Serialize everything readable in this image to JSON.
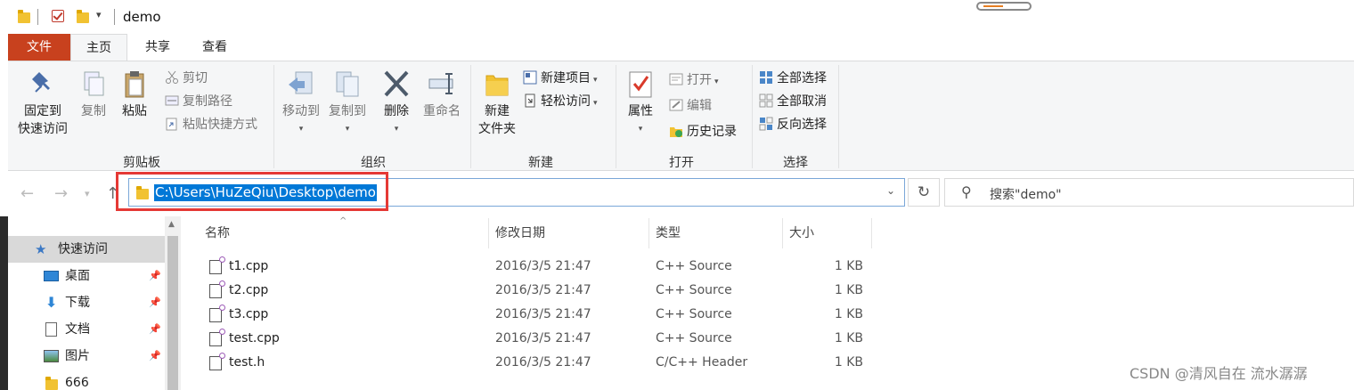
{
  "titlebar": {
    "title": "demo",
    "progress": 0.45,
    "progress_color": "#e67e22"
  },
  "tabs": {
    "file": "文件",
    "home": "主页",
    "share": "共享",
    "view": "查看"
  },
  "ribbon": {
    "clipboard": {
      "label": "剪贴板",
      "pin_line1": "固定到",
      "pin_line2": "快速访问",
      "copy": "复制",
      "paste": "粘贴",
      "cut": "剪切",
      "copy_path": "复制路径",
      "paste_shortcut": "粘贴快捷方式"
    },
    "organize": {
      "label": "组织",
      "move_to": "移动到",
      "copy_to": "复制到",
      "delete": "删除",
      "rename": "重命名"
    },
    "new": {
      "label": "新建",
      "new_folder_line1": "新建",
      "new_folder_line2": "文件夹",
      "new_item": "新建项目",
      "easy_access": "轻松访问"
    },
    "open": {
      "label": "打开",
      "properties": "属性",
      "open": "打开",
      "edit": "编辑",
      "history": "历史记录"
    },
    "select": {
      "label": "选择",
      "select_all": "全部选择",
      "select_none": "全部取消",
      "invert": "反向选择"
    }
  },
  "address": {
    "path": "C:\\Users\\HuZeQiu\\Desktop\\demo",
    "search_placeholder": "搜索\"demo\""
  },
  "sidebar": {
    "items": [
      {
        "label": "快速访问",
        "pinned": false
      },
      {
        "label": "桌面",
        "pinned": true
      },
      {
        "label": "下载",
        "pinned": true
      },
      {
        "label": "文档",
        "pinned": true
      },
      {
        "label": "图片",
        "pinned": true
      },
      {
        "label": "666",
        "pinned": false
      }
    ]
  },
  "filelist": {
    "columns": {
      "name": "名称",
      "date": "修改日期",
      "type": "类型",
      "size": "大小"
    },
    "rows": [
      {
        "name": "t1.cpp",
        "date": "2016/3/5 21:47",
        "type": "C++ Source",
        "size": "1 KB"
      },
      {
        "name": "t2.cpp",
        "date": "2016/3/5 21:47",
        "type": "C++ Source",
        "size": "1 KB"
      },
      {
        "name": "t3.cpp",
        "date": "2016/3/5 21:47",
        "type": "C++ Source",
        "size": "1 KB"
      },
      {
        "name": "test.cpp",
        "date": "2016/3/5 21:47",
        "type": "C++ Source",
        "size": "1 KB"
      },
      {
        "name": "test.h",
        "date": "2016/3/5 21:47",
        "type": "C/C++ Header",
        "size": "1 KB"
      }
    ]
  },
  "watermark": "CSDN @清风自在 流水潺潺"
}
